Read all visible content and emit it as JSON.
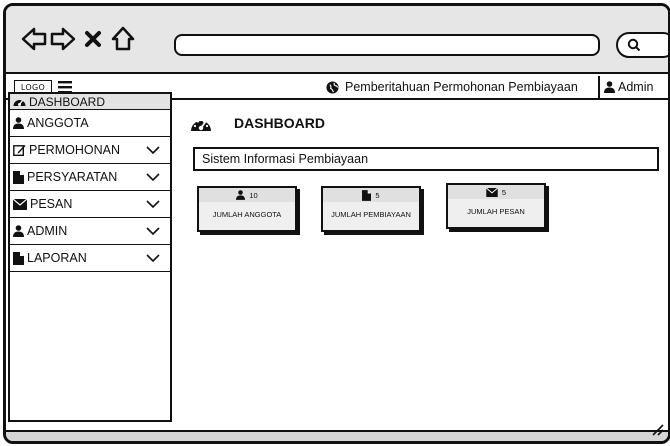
{
  "topbar": {
    "logo": "LOGO",
    "notification": "Pemberitahuan Permohonan Pembiayaan",
    "admin": "Admin"
  },
  "sidebar": {
    "header": "DASHBOARD",
    "items": [
      {
        "label": "ANGGOTA",
        "icon": "user-icon",
        "chevron": false
      },
      {
        "label": "PERMOHONAN",
        "icon": "edit-icon",
        "chevron": true
      },
      {
        "label": "PERSYARATAN",
        "icon": "file-icon",
        "chevron": true
      },
      {
        "label": "PESAN",
        "icon": "envelope-icon",
        "chevron": true
      },
      {
        "label": "ADMIN",
        "icon": "user-icon",
        "chevron": true
      },
      {
        "label": "LAPORAN",
        "icon": "file-icon",
        "chevron": true
      }
    ]
  },
  "main": {
    "title": "DASHBOARD",
    "info": "Sistem Informasi Pembiayaan",
    "cards": [
      {
        "count": "10",
        "label": "JUMLAH ANGGOTA",
        "icon": "user-icon"
      },
      {
        "count": "5",
        "label": "JUMLAH PEMBIAYAAN",
        "icon": "file-icon"
      },
      {
        "count": "5",
        "label": "JUMLAH PESAN",
        "icon": "envelope-icon"
      }
    ]
  },
  "colors": {
    "ink": "#111111",
    "chrome": "#e6e6e6",
    "card": "#efefef"
  }
}
